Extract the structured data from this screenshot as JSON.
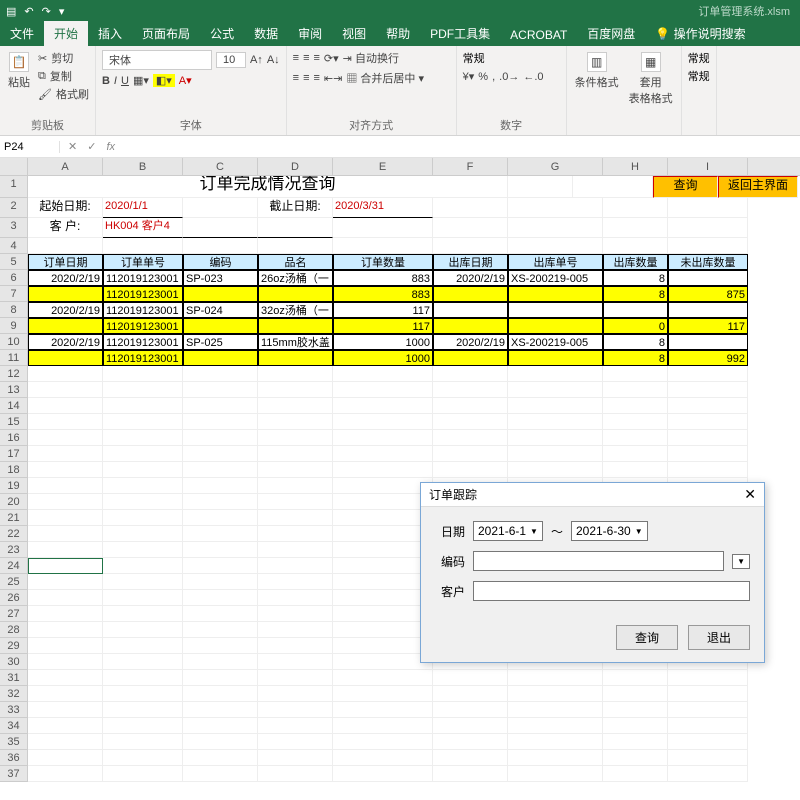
{
  "titlebar": {
    "docname": "订单管理系统.xlsm"
  },
  "menu": {
    "file": "文件",
    "home": "开始",
    "insert": "插入",
    "layout": "页面布局",
    "formula": "公式",
    "data": "数据",
    "review": "审阅",
    "view": "视图",
    "help": "帮助",
    "pdf": "PDF工具集",
    "acrobat": "ACROBAT",
    "baidu": "百度网盘",
    "tell": "操作说明搜索"
  },
  "ribbon": {
    "clipboard": {
      "paste": "粘贴",
      "cut": "剪切",
      "copy": "复制",
      "format": "格式刷",
      "name": "剪贴板"
    },
    "font": {
      "name": "字体",
      "family": "宋体",
      "size": "10"
    },
    "align": {
      "name": "对齐方式",
      "wrap": "自动换行",
      "merge": "合并后居中"
    },
    "number": {
      "name": "数字",
      "format": "常规"
    },
    "styles": {
      "cond": "条件格式",
      "table": "套用\n表格格式"
    },
    "other": {
      "normal": "常规",
      "normal2": "常规"
    }
  },
  "namebox": {
    "ref": "P24"
  },
  "cols": [
    "A",
    "B",
    "C",
    "D",
    "E",
    "F",
    "G",
    "H",
    "I"
  ],
  "sheet": {
    "title": "订单完成情况查询",
    "query_btn": "查询",
    "back_btn": "返回主界面",
    "start_label": "起始日期:",
    "start_val": "2020/1/1",
    "end_label": "截止日期:",
    "end_val": "2020/3/31",
    "cust_label": "客 户:",
    "cust_val": "HK004 客户4"
  },
  "headers": [
    "订单日期",
    "订单单号",
    "编码",
    "品名",
    "订单数量",
    "出库日期",
    "出库单号",
    "出库数量",
    "未出库数量"
  ],
  "chart_data": {
    "type": "table",
    "title": "订单完成情况查询",
    "columns": [
      "订单日期",
      "订单单号",
      "编码",
      "品名",
      "订单数量",
      "出库日期",
      "出库单号",
      "出库数量",
      "未出库数量"
    ],
    "rows": [
      {
        "d": "2020/2/19",
        "no": "112019123001",
        "code": "SP-023",
        "name": "26oz汤桶（一",
        "qty": "883",
        "odate": "2020/2/19",
        "ono": "XS-200219-005",
        "oqty": "8",
        "rest": "",
        "yel": false
      },
      {
        "d": "",
        "no": "112019123001",
        "code": "",
        "name": "",
        "qty": "883",
        "odate": "",
        "ono": "",
        "oqty": "8",
        "rest": "875",
        "yel": true
      },
      {
        "d": "2020/2/19",
        "no": "112019123001",
        "code": "SP-024",
        "name": "32oz汤桶（一",
        "qty": "117",
        "odate": "",
        "ono": "",
        "oqty": "",
        "rest": "",
        "yel": false
      },
      {
        "d": "",
        "no": "112019123001",
        "code": "",
        "name": "",
        "qty": "117",
        "odate": "",
        "ono": "",
        "oqty": "0",
        "rest": "117",
        "yel": true
      },
      {
        "d": "2020/2/19",
        "no": "112019123001",
        "code": "SP-025",
        "name": "115mm胶水盖",
        "qty": "1000",
        "odate": "2020/2/19",
        "ono": "XS-200219-005",
        "oqty": "8",
        "rest": "",
        "yel": false
      },
      {
        "d": "",
        "no": "112019123001",
        "code": "",
        "name": "",
        "qty": "1000",
        "odate": "",
        "ono": "",
        "oqty": "8",
        "rest": "992",
        "yel": true
      }
    ]
  },
  "dialog": {
    "title": "订单跟踪",
    "date_label": "日期",
    "date_from": "2021-6-1",
    "date_sep": "～",
    "date_to": "2021-6-30",
    "code_label": "编码",
    "cust_label": "客户",
    "query": "查询",
    "exit": "退出"
  }
}
